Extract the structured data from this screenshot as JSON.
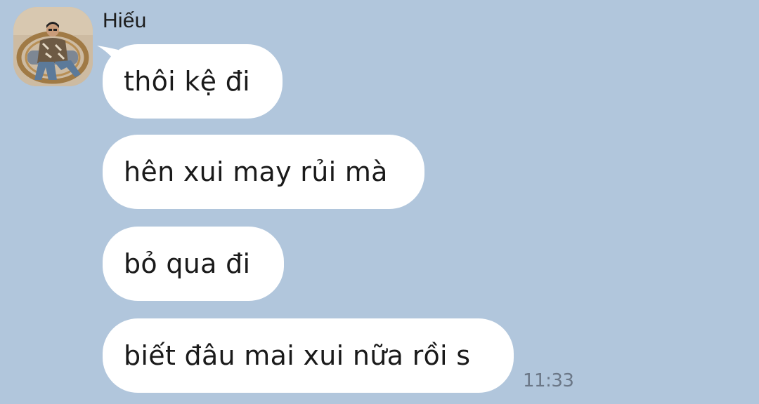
{
  "conversation": {
    "sender": {
      "name": "Hiếu",
      "avatar_icon": "profile-photo-icon"
    },
    "messages": [
      {
        "text": "thôi kệ đi"
      },
      {
        "text": "hên xui may rủi mà"
      },
      {
        "text": "bỏ qua đi"
      },
      {
        "text": "biết đâu mai xui nữa rồi s"
      }
    ],
    "last_timestamp": "11:33"
  },
  "colors": {
    "background": "#b1c6dc",
    "bubble": "#ffffff",
    "text": "#1a1a1a",
    "timestamp": "#6b7787"
  }
}
